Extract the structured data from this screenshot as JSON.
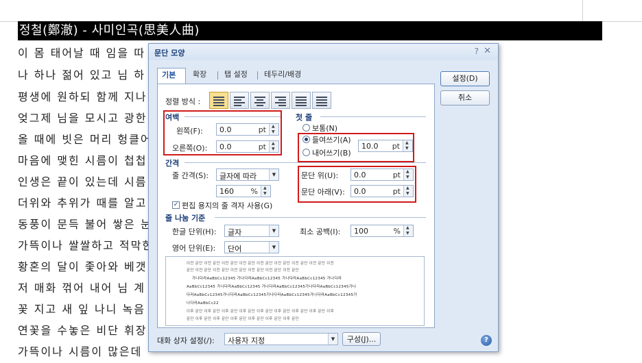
{
  "document": {
    "title": "정철(鄭澈) - 사미인곡(思美人曲)",
    "lines": [
      "이 몸 태어날 때 임을 따",
      "나 하나 젊어 있고 님 하",
      "평생에 원하되 함께 지나",
      "엊그제 님을 모시고 광한",
      "올 때에 빗은 머리 헝클어",
      "마음에 맺힌 시름이 첩첩",
      "인생은 끝이 있는데 시름",
      "더위와 추위가 때를 알고",
      "동풍이 문득 불어 쌓은 눈",
      "가뜩이나 쌀쌀하고 적막한",
      "황혼의 달이 좇아와 베갯",
      "저 매화 꺾어 내어 님 계",
      "꽃 지고 새 잎 나니 녹음",
      "연꽃을 수놓은 비단 휘장",
      "가뜩이나 시름이 많은데"
    ]
  },
  "dialog": {
    "title": "문단 모양",
    "help_glyph": "?",
    "close_glyph": "✕",
    "tabs": [
      "기본",
      "확장",
      "탭 설정",
      "테두리/배경"
    ],
    "ok_button": "설정(D)",
    "cancel_button": "취소",
    "align_label": "정렬 방식 :",
    "margin": {
      "section": "여백",
      "left_label": "왼쪽(F):",
      "left_value": "0.0",
      "right_label": "오른쪽(O):",
      "right_value": "0.0",
      "unit": "pt"
    },
    "first_line": {
      "section": "첫 줄",
      "normal_label": "보통(N)",
      "indent_label": "들여쓰기(A)",
      "outdent_label": "내어쓰기(B)",
      "value": "10.0",
      "unit": "pt"
    },
    "spacing": {
      "section": "간격",
      "line_label": "줄 간격(S):",
      "line_mode": "글자에 따라",
      "line_value": "160",
      "line_unit": "%",
      "para_above_label": "문단 위(U):",
      "para_above_value": "0.0",
      "para_below_label": "문단 아래(V):",
      "para_below_value": "0.0",
      "unit": "pt",
      "grid_label": "편집 용지의 줄 격자 사용(G)"
    },
    "line_break": {
      "section": "줄 나눔 기준",
      "korean_label": "한글 단위(H):",
      "korean_value": "글자",
      "english_label": "영어 단위(E):",
      "english_value": "단어",
      "min_space_label": "최소 공백(I):",
      "min_space_value": "100",
      "min_space_unit": "%"
    },
    "preview": {
      "lines": [
        "이전 문단 이전 문단 이전 문단 이전 문단 이전 문단 이전 문단 이전 문단 이전 문단 이전",
        "문단 이전 문단 이전 문단 이전 문단 이전 문단 이전 문단 이전 문단",
        "가나다라AaBbCc12345  가나다라AaBbCc12345  가나다라AaBbCc12345  가나다라",
        "AaBbCc12345  가나다라AaBbCc12345  가나다라AaBbCc12345가나다라AaBbCc12345가나",
        "다라AaBbCc12345가나다라AaBbCc12345가나다라AaBbCc12345가나다라AaBbCc12345가",
        "나다라AaBbCc22",
        "이후 문단 이후 문단 이후 문단 이후 문단 이후 문단 이후 문단 이후 문단 이후 문단 이후",
        "문단 이후 문단 이후 문단 이후 문단 이후 문단 이후 문단 이후 문단"
      ]
    },
    "footer": {
      "preset_label": "대화 상자 설정(/):",
      "preset_value": "사용자 지정",
      "compose_button": "구성(J)...",
      "help_glyph": "?"
    }
  },
  "colors": {
    "highlight_box": "#d01a1a",
    "dialog_bg": "#dfe9f6",
    "title_bar_bg": "#000000"
  }
}
